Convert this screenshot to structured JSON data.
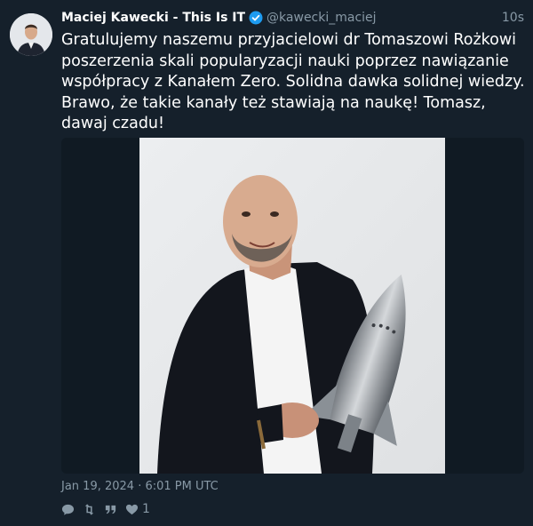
{
  "author": {
    "name": "Maciej Kawecki - This Is IT",
    "handle": "@kawecki_maciej",
    "verified": true,
    "avatar": "avatar-photo"
  },
  "tweet": {
    "time_ago": "10s",
    "text": "Gratulujemy naszemu przyjacielowi dr Tomaszowi Rożkowi poszerzenia skali popularyzacji nauki poprzez nawiązanie współpracy z Kanałem Zero. Solidna dawka solidnej wiedzy. Brawo, że takie kanały też stawiają na naukę! Tomasz, dawaj czadu!",
    "date": "Jan 19, 2024 · 6:01 PM UTC",
    "like_count": "1"
  },
  "icons": {
    "reply": "comment-icon",
    "retweet": "retweet-icon",
    "quote": "quote-icon",
    "like": "heart-icon",
    "verified": "verified-badge-icon"
  },
  "colors": {
    "background": "#15202b",
    "secondary_text": "#8899a6",
    "verified": "#1d9bf0"
  }
}
